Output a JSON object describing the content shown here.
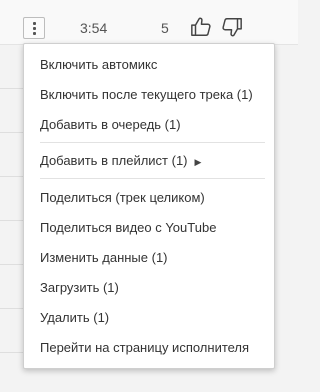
{
  "track_row": {
    "duration": "3:54",
    "rating_count": "5",
    "more_icon": "vertical-dots-icon",
    "like_icon": "thumbs-up-icon",
    "dislike_icon": "thumbs-down-icon"
  },
  "menu": {
    "items": [
      {
        "label": "Включить автомикс"
      },
      {
        "label": "Включить после текущего трека (1)"
      },
      {
        "label": "Добавить в очередь (1)"
      },
      {
        "label": "Добавить в плейлист (1)",
        "submenu_arrow": "▶"
      },
      {
        "label": "Поделиться (трек целиком)"
      },
      {
        "label": "Поделиться видео с YouTube"
      },
      {
        "label": "Изменить данные (1)"
      },
      {
        "label": "Загрузить (1)"
      },
      {
        "label": "Удалить (1)"
      },
      {
        "label": "Перейти на страницу исполнителя"
      }
    ]
  },
  "colors": {
    "text": "#333333",
    "separator": "#e2e2e2",
    "menu_bg": "#ffffff"
  }
}
